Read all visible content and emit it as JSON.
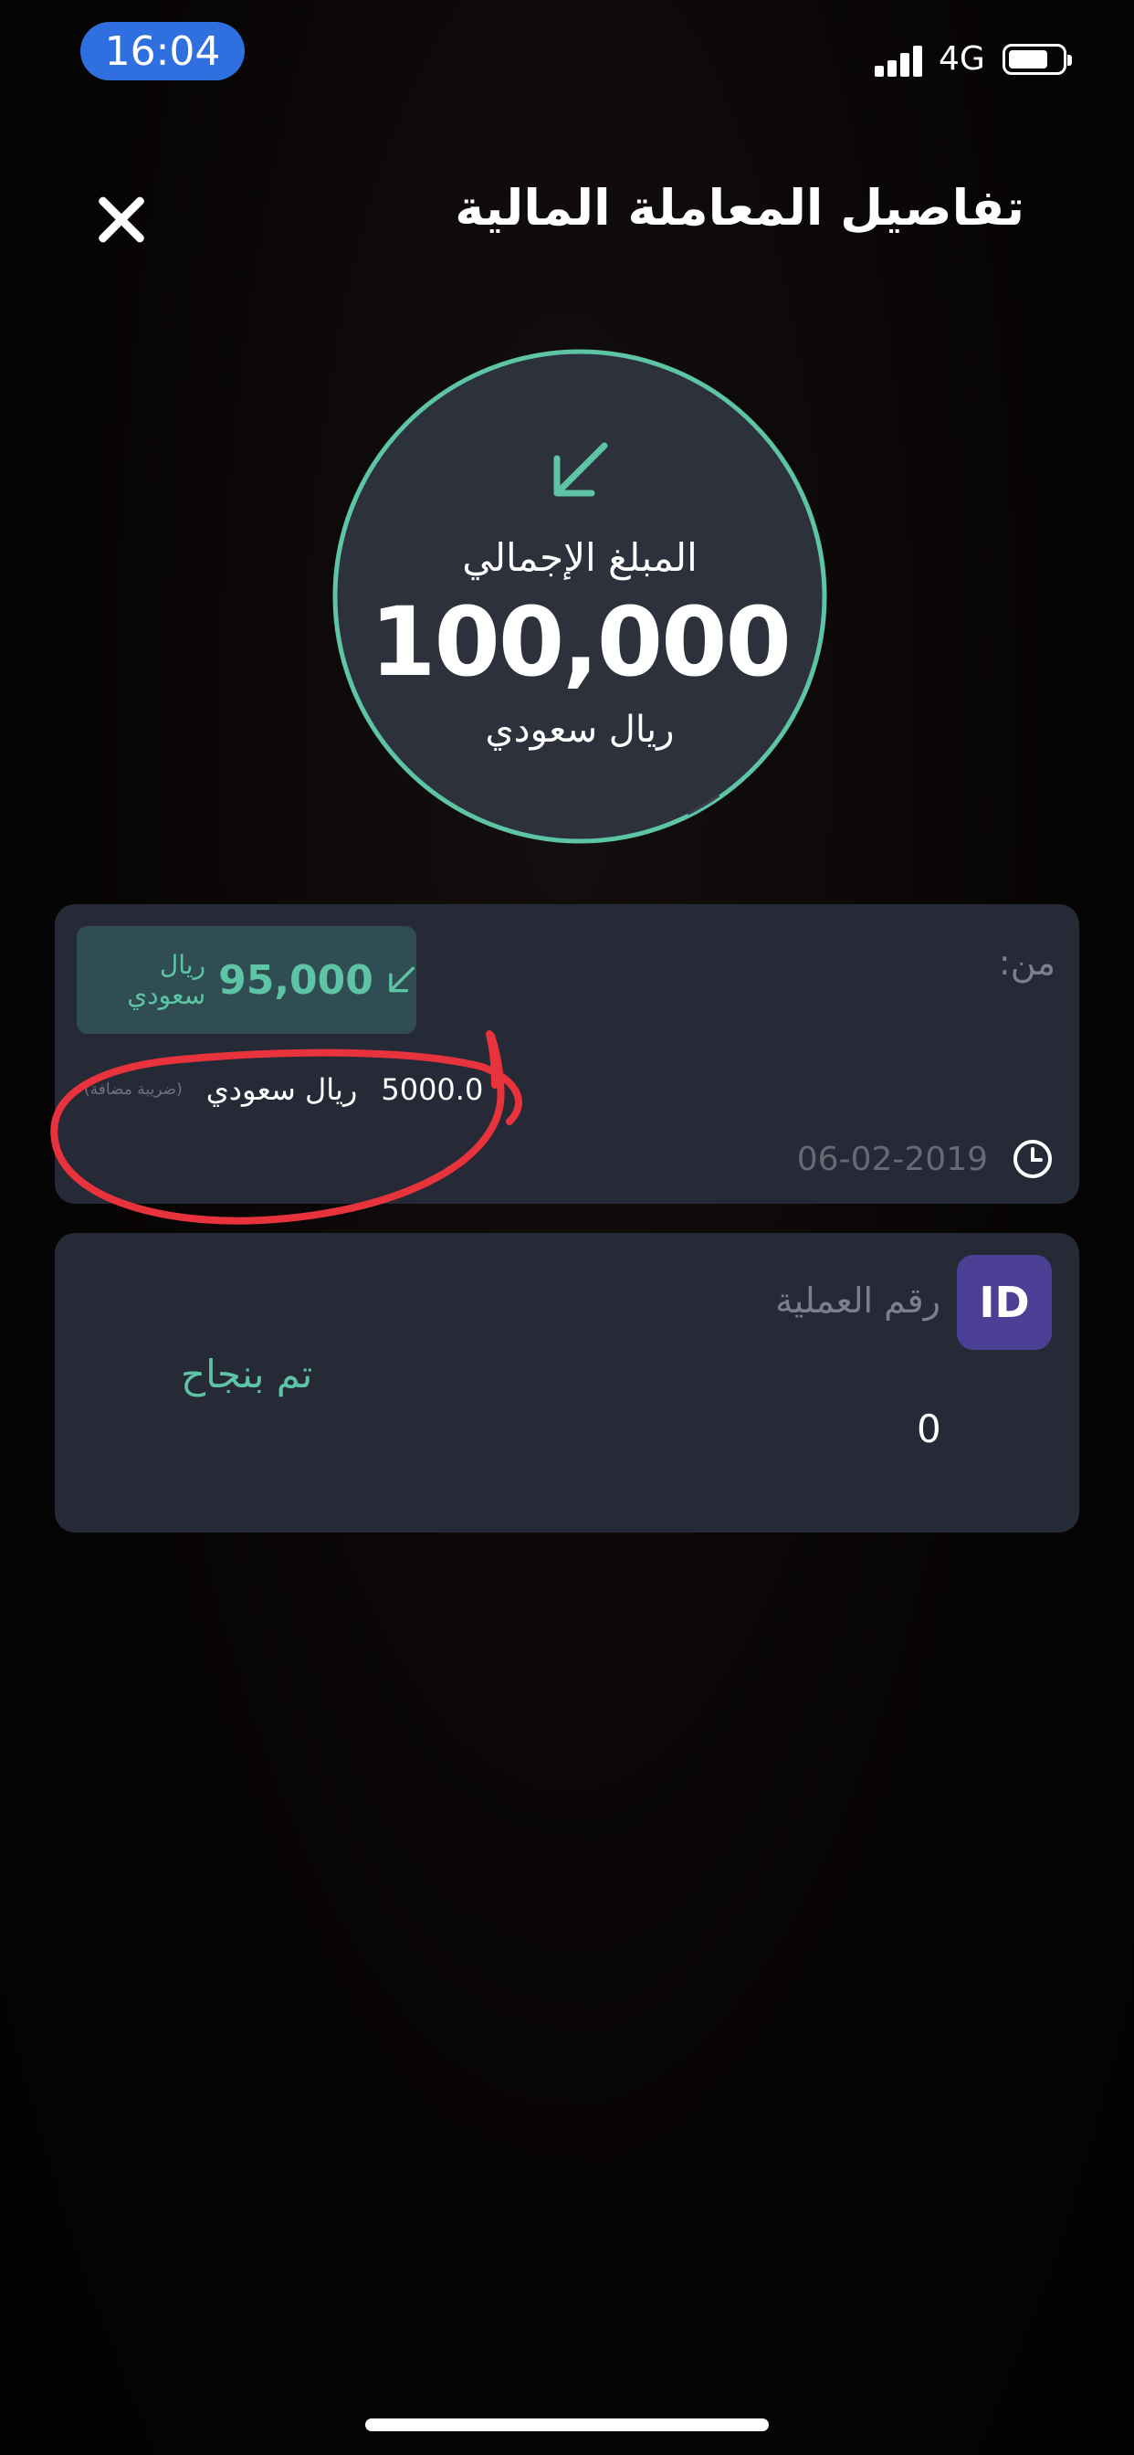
{
  "status_bar": {
    "time": "16:04",
    "network": "4G"
  },
  "header": {
    "title": "تفاصيل المعاملة المالية",
    "close_icon": "close-icon"
  },
  "total": {
    "label": "المبلغ الإجمالي",
    "amount": "100,000",
    "currency": "ريال سعودي",
    "direction_icon": "arrow-down-left-icon"
  },
  "transfer": {
    "from_label": "من:",
    "net_amount": "95,000",
    "net_currency": "ريال سعودي",
    "vat_amount": "5000.0",
    "vat_currency": "ريال سعودي",
    "vat_tag": "(ضريبة مضافة)",
    "date": "06-02-2019"
  },
  "operation": {
    "id_badge": "ID",
    "label": "رقم العملية",
    "status": "تم بنجاح",
    "number": "0"
  },
  "colors": {
    "accent": "#5ec4a6",
    "card": "#262a36",
    "id_badge": "#4b3f96",
    "annotation": "#e8333c"
  }
}
